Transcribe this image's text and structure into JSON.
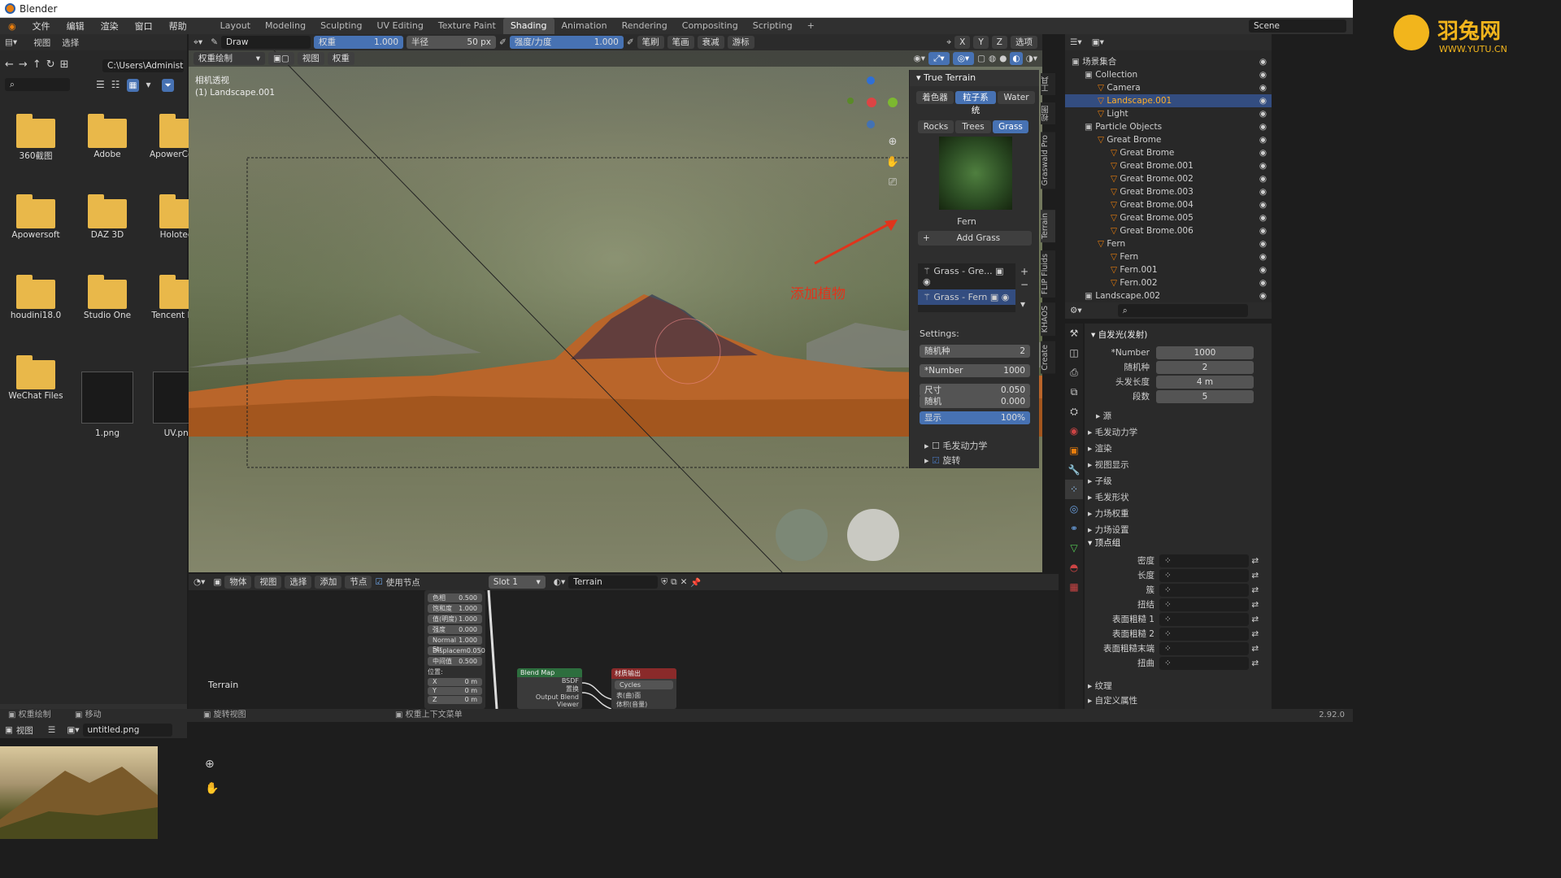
{
  "app": {
    "title": "Blender"
  },
  "menu": {
    "items": [
      "文件",
      "编辑",
      "渲染",
      "窗口",
      "帮助"
    ],
    "workspaces": [
      "Layout",
      "Modeling",
      "Sculpting",
      "UV Editing",
      "Texture Paint",
      "Shading",
      "Animation",
      "Rendering",
      "Compositing",
      "Scripting"
    ],
    "active_workspace": "Shading",
    "add": "+",
    "scene": "Scene"
  },
  "toolbar": {
    "brush": "Draw",
    "weight_label": "权重",
    "weight_value": "1.000",
    "radius_label": "半径",
    "radius_value": "50 px",
    "strength_label": "强度/力度",
    "strength_value": "1.000",
    "menus": [
      "笔刷",
      "笔画",
      "衰减",
      "游标"
    ],
    "axes": [
      "X",
      "Y",
      "Z"
    ],
    "options": "选项"
  },
  "viewport_header": {
    "mode": "权重绘制",
    "menus": [
      "视图",
      "权重"
    ]
  },
  "viewport": {
    "camera_label": "相机透视",
    "object_label": "(1) Landscape.001",
    "annotation": "添加植物"
  },
  "filebrowser": {
    "menus": [
      "视图",
      "选择"
    ],
    "path": "C:\\Users\\Administrat...",
    "folders": [
      "360截图",
      "Adobe",
      "ApowerComp...",
      "Apowersoft",
      "DAZ 3D",
      "Holotech",
      "houdini18.0",
      "Studio One",
      "Tencent Files",
      "WeChat Files"
    ],
    "images": [
      "1.png",
      "UV.png"
    ]
  },
  "imageeditor": {
    "menu": "视图",
    "image": "untitled.png"
  },
  "true_terrain": {
    "title": "True Terrain",
    "tabs": [
      "着色器",
      "粒子系统",
      "Water"
    ],
    "active_tab": "粒子系统",
    "subtabs": [
      "Rocks",
      "Trees",
      "Grass"
    ],
    "active_subtab": "Grass",
    "preview_label": "Fern",
    "add_button": "Add Grass",
    "particle_slots": [
      "Grass - Gre...",
      "Grass - Fern"
    ],
    "settings_label": "Settings:",
    "settings": [
      {
        "label": "随机种",
        "value": "2"
      },
      {
        "label": "*Number",
        "value": "1000"
      },
      {
        "label": "尺寸",
        "value": "0.050"
      },
      {
        "label": "随机",
        "value": "0.000"
      }
    ],
    "display": {
      "label": "显示",
      "value": "100%",
      "fraction": 1.0
    },
    "options": [
      {
        "label": "毛发动力学",
        "checked": false
      },
      {
        "label": "旋转",
        "checked": true
      }
    ]
  },
  "side_tabs": [
    "工具",
    "视图",
    "Graswald Pro",
    "Terrain",
    "FLIP Fluids",
    "KHAOS",
    "Create"
  ],
  "outliner": {
    "rows": [
      {
        "label": "场景集合",
        "indent": 0
      },
      {
        "label": "Collection",
        "indent": 1
      },
      {
        "label": "Camera",
        "indent": 2
      },
      {
        "label": "Landscape.001",
        "indent": 2,
        "selected": true
      },
      {
        "label": "Light",
        "indent": 2
      },
      {
        "label": "Particle Objects",
        "indent": 1
      },
      {
        "label": "Great Brome",
        "indent": 2
      },
      {
        "label": "Great Brome",
        "indent": 3
      },
      {
        "label": "Great Brome.001",
        "indent": 3
      },
      {
        "label": "Great Brome.002",
        "indent": 3
      },
      {
        "label": "Great Brome.003",
        "indent": 3
      },
      {
        "label": "Great Brome.004",
        "indent": 3
      },
      {
        "label": "Great Brome.005",
        "indent": 3
      },
      {
        "label": "Great Brome.006",
        "indent": 3
      },
      {
        "label": "Fern",
        "indent": 2
      },
      {
        "label": "Fern",
        "indent": 3
      },
      {
        "label": "Fern.001",
        "indent": 3
      },
      {
        "label": "Fern.002",
        "indent": 3
      },
      {
        "label": "Landscape.002",
        "indent": 1
      }
    ]
  },
  "properties": {
    "section": "自发光(发射)",
    "fields": [
      {
        "label": "*Number",
        "value": "1000"
      },
      {
        "label": "随机种",
        "value": "2"
      },
      {
        "label": "头发长度",
        "value": "4 m"
      },
      {
        "label": "段数",
        "value": "5"
      }
    ],
    "source": "源",
    "groups": [
      "毛发动力学",
      "渲染",
      "视图显示",
      "子级",
      "毛发形状",
      "力场权重",
      "力场设置"
    ],
    "vertex_group": "顶点组",
    "vertex_fields": [
      "密度",
      "长度",
      "簇",
      "扭结",
      "表面粗糙 1",
      "表面粗糙 2",
      "表面粗糙末端",
      "扭曲"
    ],
    "bottom": [
      "纹理",
      "自定义属性"
    ]
  },
  "node_editor": {
    "mode": "物体",
    "menus": [
      "视图",
      "选择",
      "添加",
      "节点"
    ],
    "use_nodes": "使用节点",
    "slot": "Slot 1",
    "material": "Terrain",
    "frame_label": "Terrain",
    "node_values": [
      {
        "label": "色相",
        "value": "0.500"
      },
      {
        "label": "饱和度",
        "value": "1.000"
      },
      {
        "label": "值(明度)",
        "value": "1.000"
      },
      {
        "label": "强度",
        "value": "0.000"
      },
      {
        "label": "Normal Str",
        "value": "1.000"
      },
      {
        "label": "Displacem",
        "value": "0.050"
      },
      {
        "label": "中间值",
        "value": "0.500"
      }
    ],
    "pos_label": "位置:",
    "xyz": [
      {
        "label": "X",
        "value": "0 m"
      },
      {
        "label": "Y",
        "value": "0 m"
      },
      {
        "label": "Z",
        "value": "0 m"
      }
    ],
    "blend_node": {
      "title": "Blend Map",
      "outs": [
        "BSDF",
        "置换",
        "Output Blend Viewer"
      ]
    },
    "output_node": {
      "title": "材质输出",
      "engine": "Cycles",
      "ins": [
        "表(曲)面",
        "体积(音量)"
      ]
    }
  },
  "status": {
    "items": [
      "权重绘制",
      "移动",
      "旋转视图",
      "权重上下文菜单"
    ],
    "version": "2.92.0"
  },
  "brand": {
    "logo_text": "羽兔网",
    "url": "WWW.YUTU.CN"
  },
  "colors": {
    "accent": "#4772b3",
    "annotation": "#e0341c",
    "orange": "#e87d0d"
  }
}
